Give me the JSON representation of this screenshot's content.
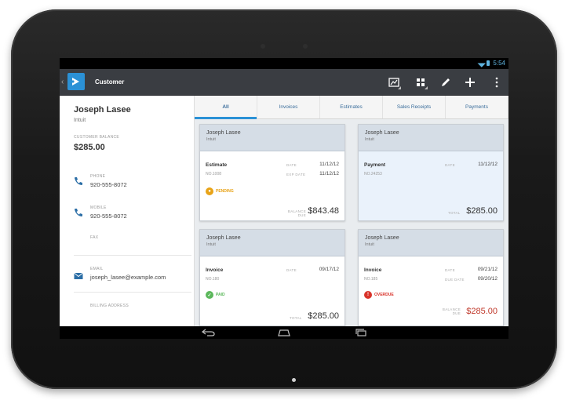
{
  "status_bar": {
    "time": "5:54"
  },
  "action_bar": {
    "back": "‹",
    "title": "Customer",
    "icons": [
      "reports-icon",
      "grid-icon",
      "edit-icon",
      "add-icon",
      "overflow-icon"
    ],
    "accent": "#2b91d6"
  },
  "customer": {
    "name": "Joseph Lasee",
    "company": "Intuit",
    "balance_label": "CUSTOMER BALANCE",
    "balance": "$285.00",
    "phone_label": "PHONE",
    "phone": "920-555-8072",
    "mobile_label": "MOBILE",
    "mobile": "920-555-8072",
    "fax_label": "FAX",
    "email_label": "EMAIL",
    "email": "joseph_lasee@example.com",
    "billing_label": "BILLING ADDRESS"
  },
  "tabs": [
    "All",
    "Invoices",
    "Estimates",
    "Sales Receipts",
    "Payments"
  ],
  "cards": [
    {
      "name": "Joseph Lasee",
      "company": "Intuit",
      "type": "Estimate",
      "no": "NO.1008",
      "date_label": "DATE",
      "date": "11/12/12",
      "exp_label": "EXP DATE",
      "exp": "11/12/12",
      "status": "PENDING",
      "status_color": "#e8a317",
      "total_label": "BALANCE DUE",
      "total": "$843.48"
    },
    {
      "name": "Joseph Lasee",
      "company": "Intuit",
      "type": "Payment",
      "no": "NO.24253",
      "date_label": "DATE",
      "date": "11/12/12",
      "total_label": "TOTAL",
      "total": "$285.00"
    },
    {
      "name": "Joseph Lasee",
      "company": "Intuit",
      "type": "Invoice",
      "no": "NO.180",
      "date_label": "DATE",
      "date": "09/17/12",
      "status": "PAID",
      "status_color": "#5cb85c",
      "total_label": "TOTAL",
      "total": "$285.00"
    },
    {
      "name": "Joseph Lasee",
      "company": "Intuit",
      "type": "Invoice",
      "no": "NO.185",
      "date_label": "DATE",
      "date": "09/21/12",
      "due_label": "DUE DATE",
      "due": "09/20/12",
      "status": "OVERDUE",
      "status_color": "#d9342b",
      "total_label": "BALANCE DUE",
      "total": "$285.00"
    }
  ],
  "nav_bar": {
    "icons": [
      "back-icon",
      "home-icon",
      "recents-icon"
    ]
  }
}
